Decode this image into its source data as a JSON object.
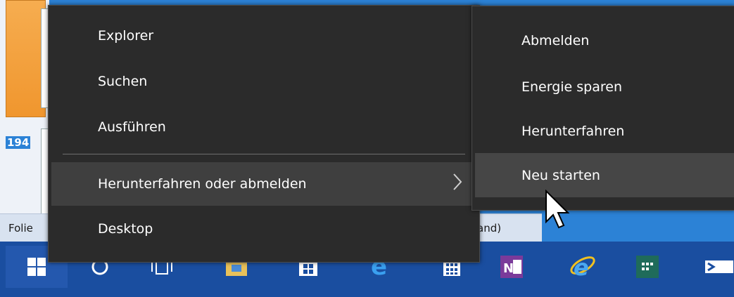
{
  "background": {
    "slide_number": "194",
    "statusbar_left": "Folie",
    "statusbar_right": "and)"
  },
  "menu": {
    "items": [
      {
        "label": "Explorer"
      },
      {
        "label": "Suchen"
      },
      {
        "label": "Ausführen"
      },
      {
        "label": "Herunterfahren oder abmelden"
      },
      {
        "label": "Desktop"
      }
    ]
  },
  "submenu": {
    "items": [
      {
        "label": "Abmelden"
      },
      {
        "label": "Energie sparen"
      },
      {
        "label": "Herunterfahren"
      },
      {
        "label": "Neu starten"
      }
    ]
  },
  "taskbar": {
    "icons": [
      "windows-start-icon",
      "cortana-circle-icon",
      "task-view-icon",
      "file-explorer-icon",
      "store-icon",
      "edge-icon",
      "calculator-icon",
      "onenote-icon",
      "internet-explorer-icon",
      "app-icon",
      "terminal-icon"
    ]
  },
  "colors": {
    "menu_bg": "#2b2b2b",
    "menu_hover": "#3f3f3f",
    "taskbar": "#1a4ea0"
  }
}
